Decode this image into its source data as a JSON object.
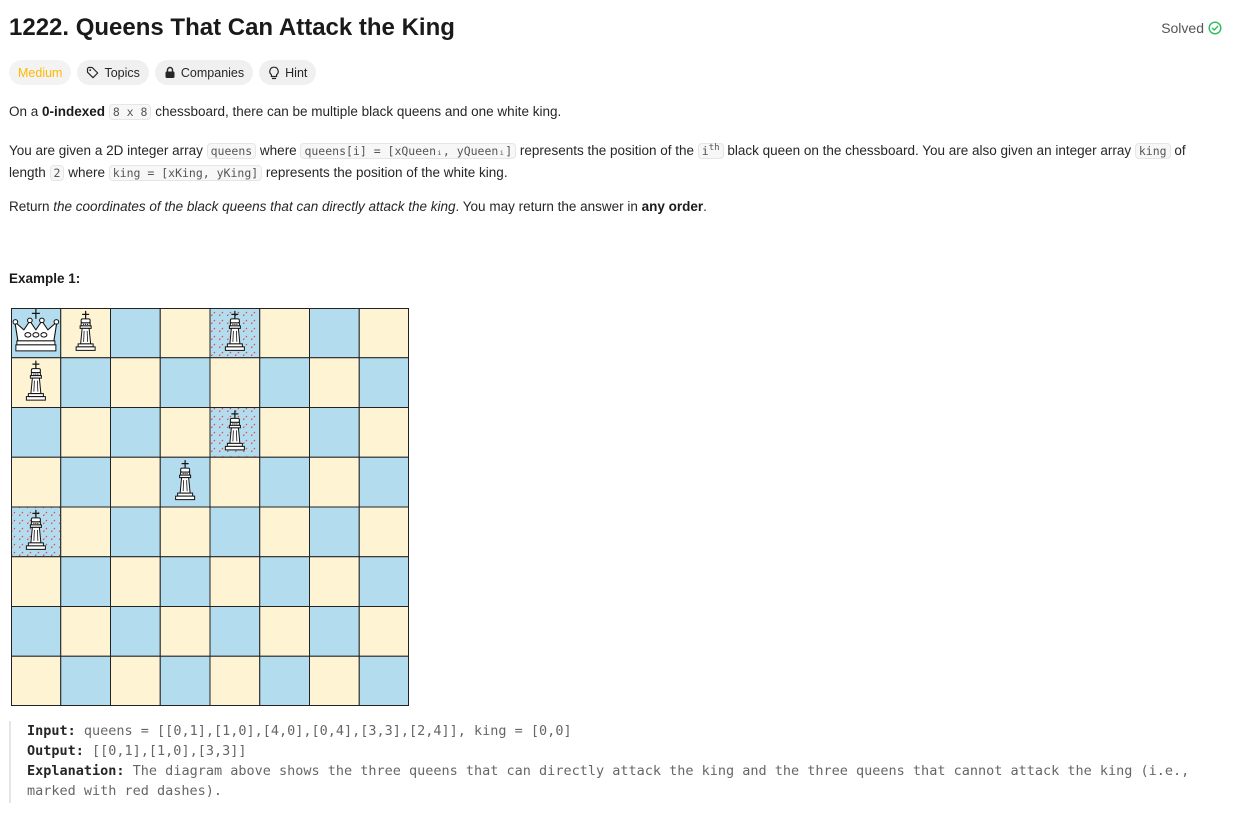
{
  "header": {
    "title": "1222. Queens That Can Attack the King",
    "status": "Solved"
  },
  "tags": {
    "difficulty": "Medium",
    "topics": "Topics",
    "companies": "Companies",
    "hint": "Hint"
  },
  "description": {
    "p1": {
      "a": "On a ",
      "b_bold": "0-indexed",
      "c": " ",
      "code1": "8 x 8",
      "d": " chessboard, there can be multiple black queens and one white king."
    },
    "p2": {
      "a": "You are given a 2D integer array ",
      "code1": "queens",
      "b": " where ",
      "code2": "queens[i] = [xQueenᵢ, yQueenᵢ]",
      "c": " represents the position of the ",
      "code3_base": "i",
      "code3_sup": "th",
      "d": " black queen on the chessboard. You are also given an integer array ",
      "code4": "king",
      "e": " of length ",
      "code5": "2",
      "f": " where ",
      "code6": "king = [xKing, yKing]",
      "g": " represents the position of the white king."
    },
    "p3": {
      "a": "Return ",
      "b_italic": "the coordinates of the black queens that can directly attack the king",
      "c": ". You may return the answer in ",
      "d_bold": "any order",
      "e": "."
    }
  },
  "example": {
    "title": "Example 1:",
    "input_label": "Input:",
    "input_value": " queens = [[0,1],[1,0],[4,0],[0,4],[3,3],[2,4]], king = [0,0]",
    "output_label": "Output:",
    "output_value": " [[0,1],[1,0],[3,3]]",
    "explanation_label": "Explanation:",
    "explanation_value": " The diagram above shows the three queens that can directly attack the king and the three queens that cannot attack the king (i.e., marked with red dashes)."
  },
  "board": {
    "size": 8,
    "king": [
      0,
      0
    ],
    "attacking_queens": [
      [
        0,
        1
      ],
      [
        1,
        0
      ],
      [
        3,
        3
      ]
    ],
    "blocked_queens": [
      [
        4,
        0
      ],
      [
        0,
        4
      ],
      [
        2,
        4
      ]
    ],
    "colors": {
      "light": "#fef3d2",
      "dark": "#b3dcef",
      "dash": "#e03c3c"
    }
  },
  "colors": {
    "medium": "#ffb800",
    "solved": "#2cbb5d"
  }
}
